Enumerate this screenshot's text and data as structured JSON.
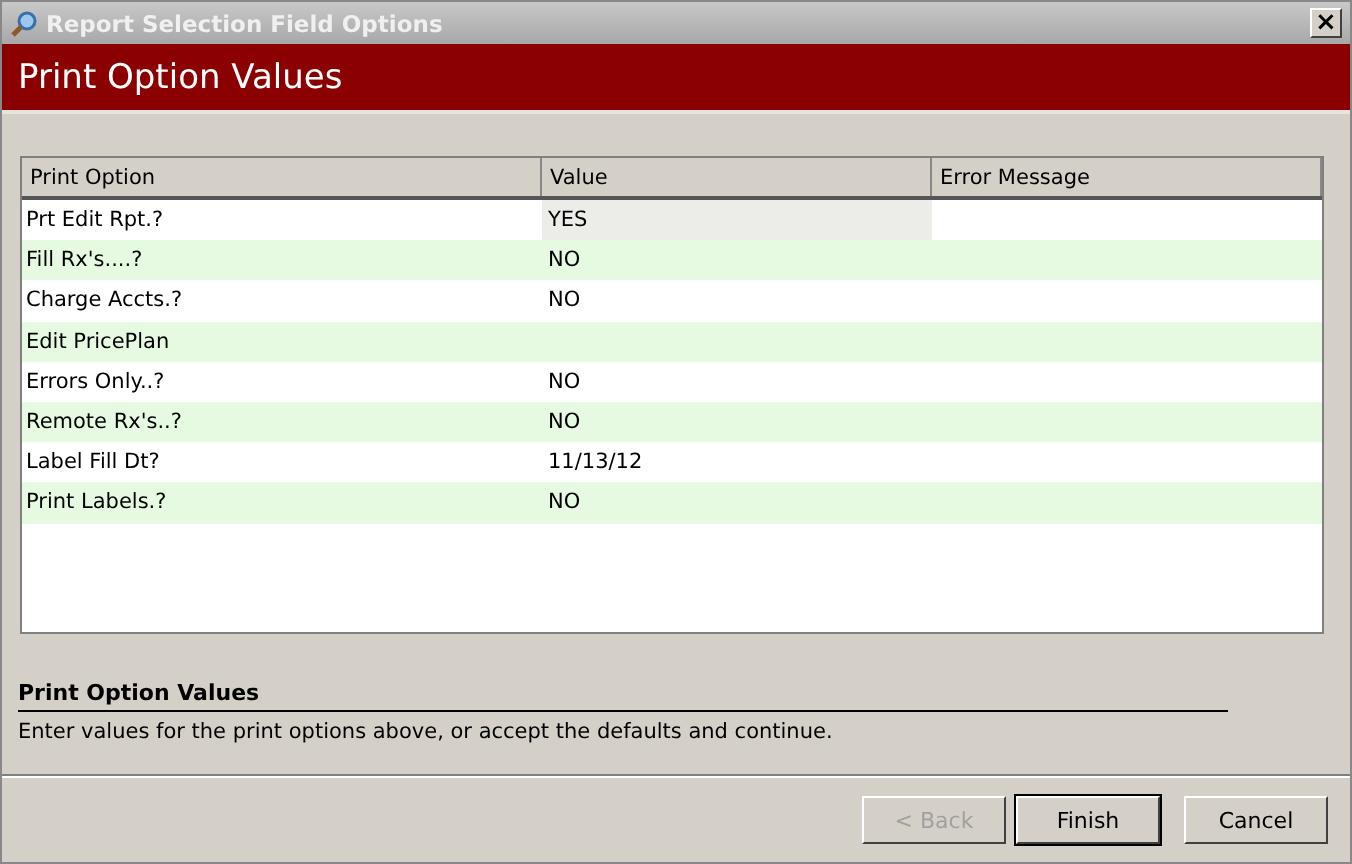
{
  "window": {
    "title": "Report Selection Field Options",
    "close": "×"
  },
  "header": {
    "title": "Print Option Values"
  },
  "table": {
    "columns": [
      "Print Option",
      "Value",
      "Error Message"
    ],
    "rows": [
      {
        "option": "Prt Edit Rpt.?",
        "value": "YES",
        "selected": true
      },
      {
        "option": "Fill Rx's....?",
        "value": "NO",
        "selected": false
      },
      {
        "option": "Charge Accts.?",
        "value": "NO",
        "selected": false
      },
      {
        "option": "Edit PricePlan",
        "value": "",
        "selected": false
      },
      {
        "option": "Errors Only..?",
        "value": "NO",
        "selected": false
      },
      {
        "option": "Remote Rx's..?",
        "value": "NO",
        "selected": false
      },
      {
        "option": "Label Fill Dt?",
        "value": "11/13/12",
        "selected": false
      },
      {
        "option": "Print Labels.?",
        "value": "NO",
        "selected": false
      }
    ]
  },
  "help": {
    "title": "Print Option Values",
    "text": "Enter values for the print options above, or accept the defaults and continue."
  },
  "buttons": [
    {
      "label": "< Back",
      "disabled": true,
      "default": false
    },
    {
      "label": "Finish",
      "disabled": false,
      "default": true
    },
    {
      "label": "Cancel",
      "disabled": false,
      "default": false
    }
  ]
}
